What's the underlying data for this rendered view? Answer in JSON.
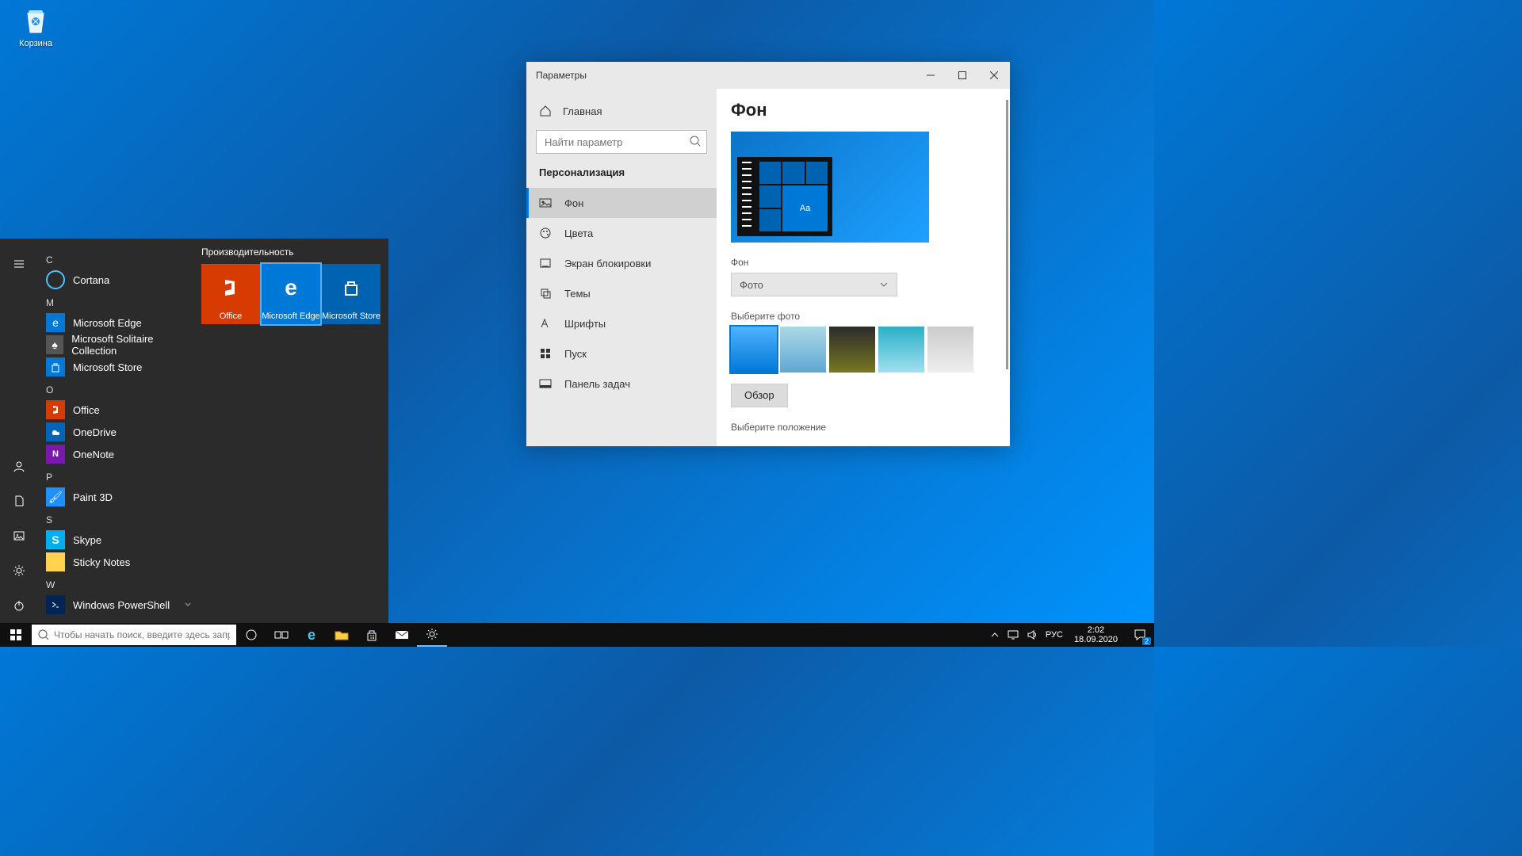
{
  "desktop": {
    "recycle_bin": "Корзина"
  },
  "settings": {
    "title": "Параметры",
    "home": "Главная",
    "search_placeholder": "Найти параметр",
    "section": "Персонализация",
    "items": [
      "Фон",
      "Цвета",
      "Экран блокировки",
      "Темы",
      "Шрифты",
      "Пуск",
      "Панель задач"
    ],
    "content": {
      "heading": "Фон",
      "preview_tile_text": "Aa",
      "bg_label": "Фон",
      "bg_value": "Фото",
      "choose_photo": "Выберите фото",
      "browse": "Обзор",
      "choose_fit": "Выберите положение"
    }
  },
  "start": {
    "tiles_heading": "Производительность",
    "tiles": [
      "Office",
      "Microsoft Edge",
      "Microsoft Store"
    ],
    "apps": {
      "C": [
        "Cortana"
      ],
      "M": [
        "Microsoft Edge",
        "Microsoft Solitaire Collection",
        "Microsoft Store"
      ],
      "O": [
        "Office",
        "OneDrive",
        "OneNote"
      ],
      "P": [
        "Paint 3D"
      ],
      "S": [
        "Skype",
        "Sticky Notes"
      ],
      "W": [
        "Windows PowerShell"
      ]
    }
  },
  "taskbar": {
    "search_placeholder": "Чтобы начать поиск, введите здесь запрос",
    "lang": "РУС",
    "time": "2:02",
    "date": "18.09.2020",
    "notif_count": "2"
  }
}
